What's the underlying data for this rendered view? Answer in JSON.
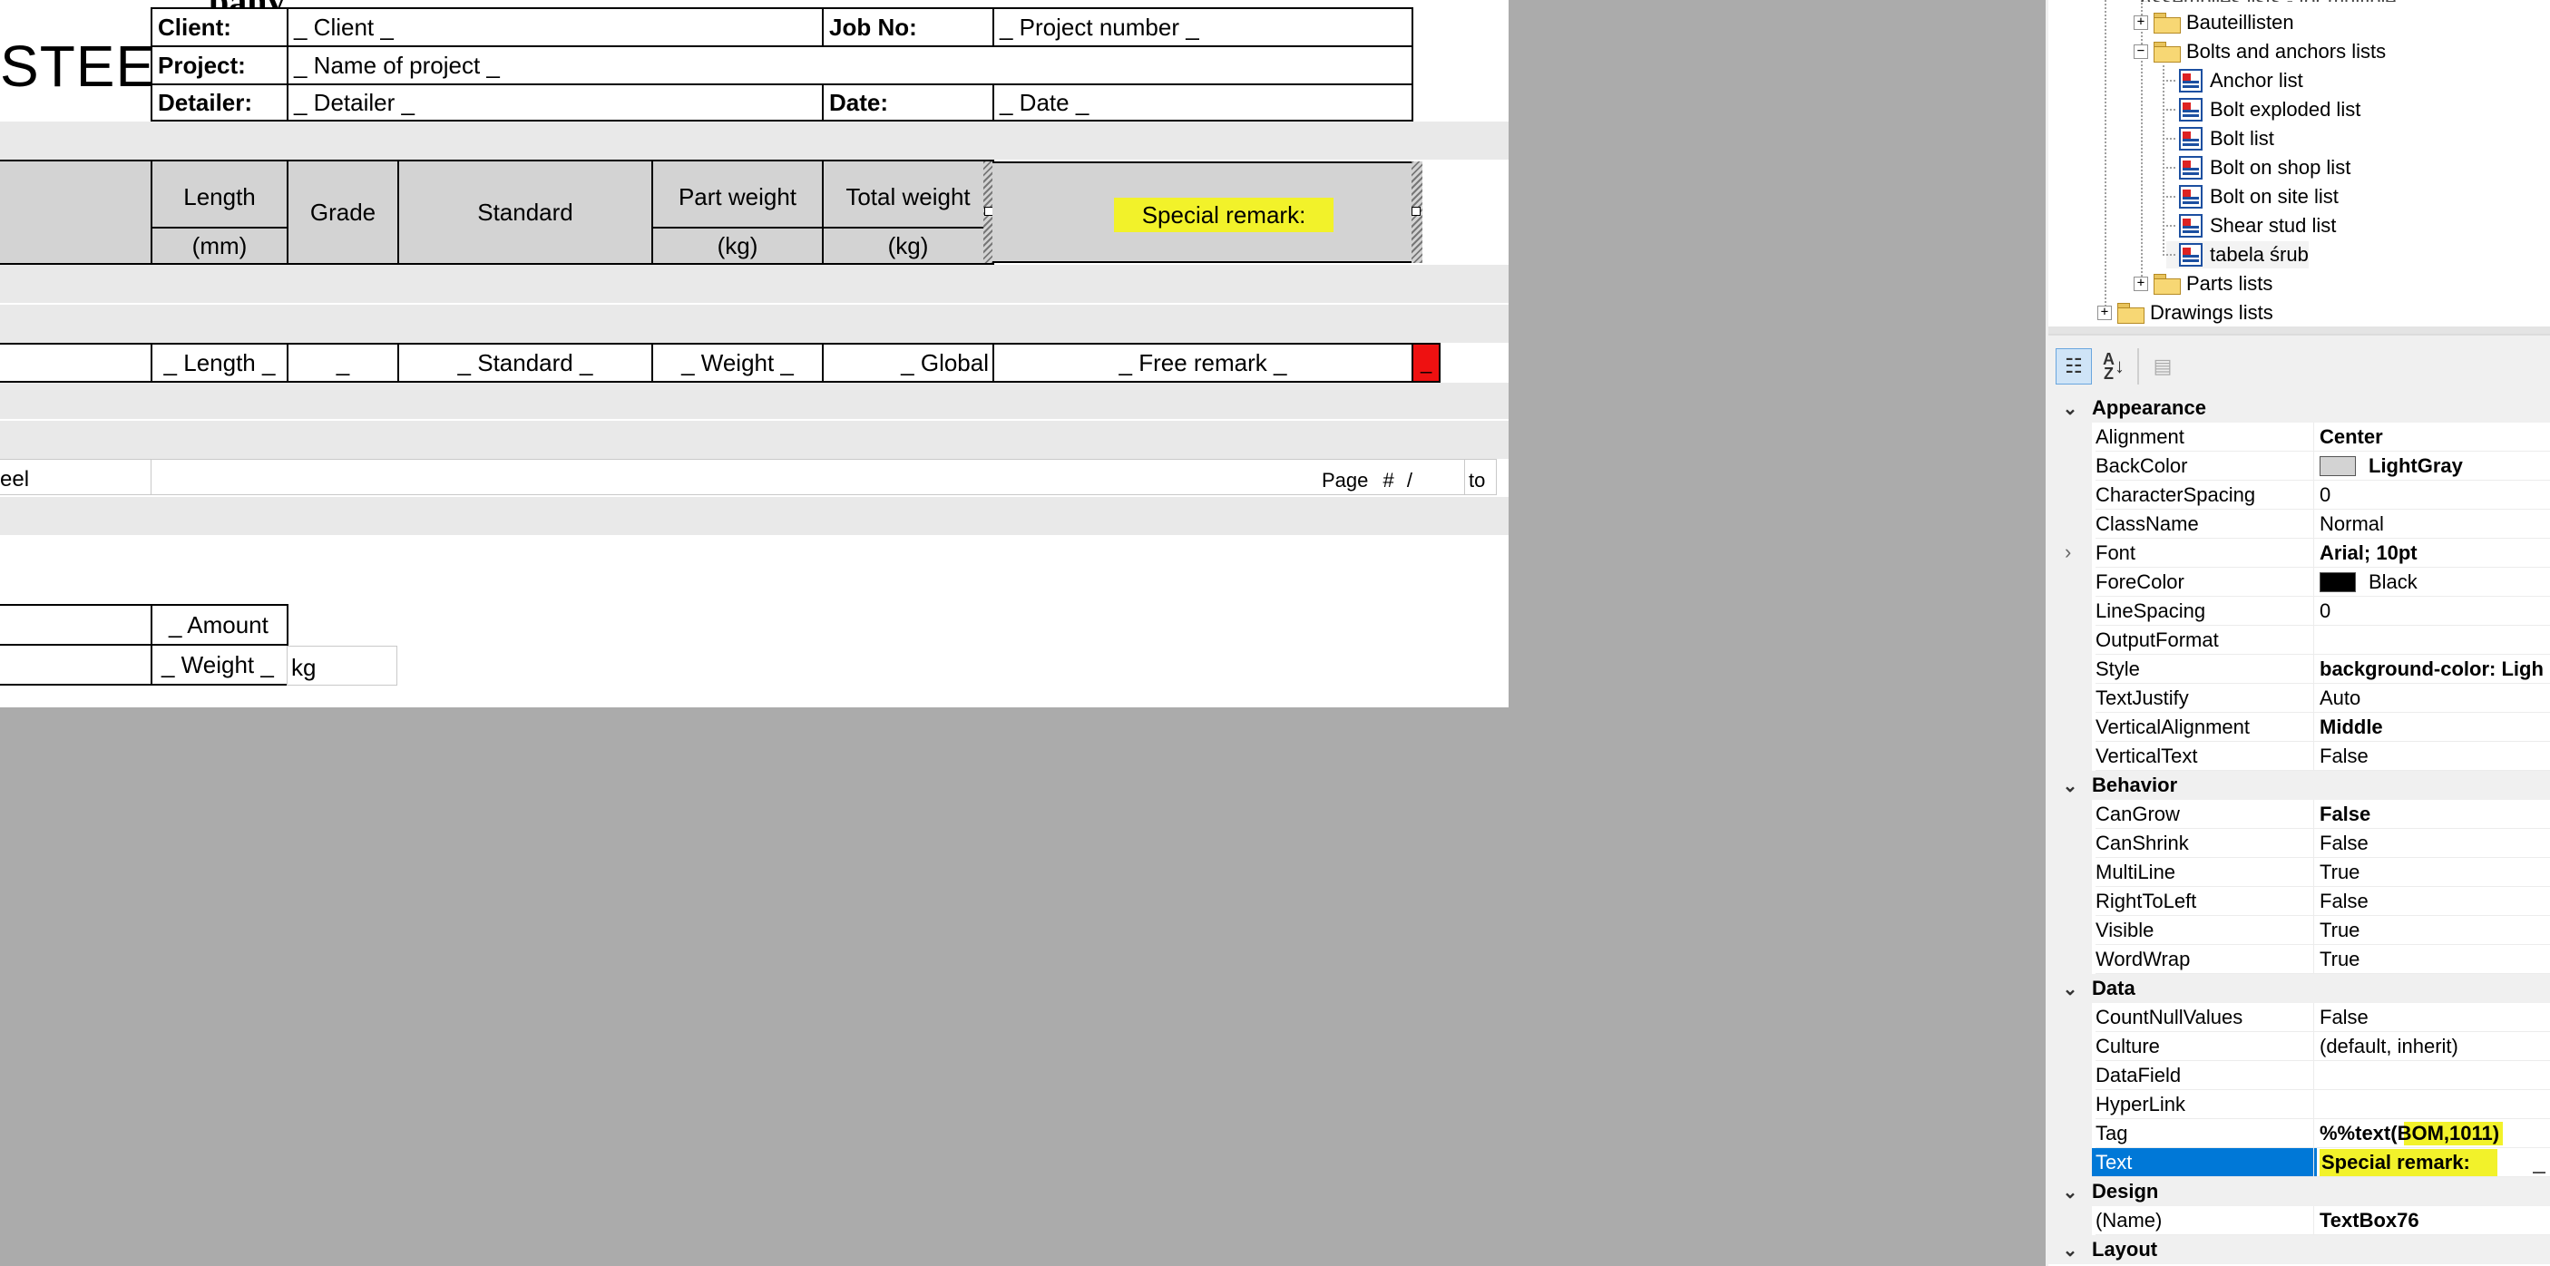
{
  "report": {
    "company_text": "STEEL",
    "header": {
      "client_label": "Client:",
      "client_value": "_ Client _",
      "jobno_label": "Job No:",
      "jobno_value": "_ Project number _",
      "project_label": "Project:",
      "project_value": "_ Name of project _",
      "detailer_label": "Detailer:",
      "detailer_value": "_ Detailer _",
      "date_label": "Date:",
      "date_value": "_ Date _"
    },
    "columns": [
      {
        "label": "Length",
        "unit": "(mm)"
      },
      {
        "label": "Grade",
        "unit": ""
      },
      {
        "label": "Standard",
        "unit": ""
      },
      {
        "label": "Part weight",
        "unit": "(kg)"
      },
      {
        "label": "Total weight",
        "unit": "(kg)"
      },
      {
        "label": "Special remark:",
        "unit": ""
      }
    ],
    "data_row": [
      "_ Length _",
      "_",
      "_ Standard _",
      "_ Weight _",
      "_ Global",
      "_ Free remark _",
      "_"
    ],
    "footer_left": "eel",
    "footer_page": "Page",
    "footer_hash": "#",
    "footer_slash": "/",
    "footer_to": "to",
    "summary": {
      "amount": "_ Amount",
      "weight": "_ Weight _",
      "kg": "kg"
    }
  },
  "tree": {
    "items": [
      {
        "label": "Bauteillisten",
        "kind": "folder",
        "expander": "+"
      },
      {
        "label": "Bolts and anchors lists",
        "kind": "folder",
        "expander": "−"
      },
      {
        "label": "Anchor list",
        "kind": "report"
      },
      {
        "label": "Bolt exploded list",
        "kind": "report"
      },
      {
        "label": "Bolt list",
        "kind": "report"
      },
      {
        "label": "Bolt on shop list",
        "kind": "report"
      },
      {
        "label": "Bolt on site list",
        "kind": "report"
      },
      {
        "label": "Shear stud list",
        "kind": "report"
      },
      {
        "label": "tabela śrub",
        "kind": "report"
      },
      {
        "label": "Parts lists",
        "kind": "folder",
        "expander": "+"
      },
      {
        "label": "Drawings lists",
        "kind": "folder",
        "expander": "+"
      }
    ]
  },
  "toolbar": {
    "categorized_icon": "categorized-icon",
    "alphabetical_icon": "sort-az-icon",
    "property_pages_icon": "property-pages-icon"
  },
  "properties": {
    "appearance": {
      "title": "Appearance",
      "rows": [
        {
          "name": "Alignment",
          "value": "Center",
          "bold": true
        },
        {
          "name": "BackColor",
          "value": "LightGray",
          "bold": true,
          "swatch": "#d3d3d3"
        },
        {
          "name": "CharacterSpacing",
          "value": "0"
        },
        {
          "name": "ClassName",
          "value": "Normal"
        },
        {
          "name": "Font",
          "value": "Arial; 10pt",
          "bold": true,
          "expander": true
        },
        {
          "name": "ForeColor",
          "value": "Black",
          "swatch": "#000000"
        },
        {
          "name": "LineSpacing",
          "value": "0"
        },
        {
          "name": "OutputFormat",
          "value": ""
        },
        {
          "name": "Style",
          "value": "background-color: Ligh",
          "bold": true
        },
        {
          "name": "TextJustify",
          "value": "Auto"
        },
        {
          "name": "VerticalAlignment",
          "value": "Middle",
          "bold": true
        },
        {
          "name": "VerticalText",
          "value": "False"
        }
      ]
    },
    "behavior": {
      "title": "Behavior",
      "rows": [
        {
          "name": "CanGrow",
          "value": "False",
          "bold": true
        },
        {
          "name": "CanShrink",
          "value": "False"
        },
        {
          "name": "MultiLine",
          "value": "True"
        },
        {
          "name": "RightToLeft",
          "value": "False"
        },
        {
          "name": "Visible",
          "value": "True"
        },
        {
          "name": "WordWrap",
          "value": "True"
        }
      ]
    },
    "data": {
      "title": "Data",
      "rows": [
        {
          "name": "CountNullValues",
          "value": "False"
        },
        {
          "name": "Culture",
          "value": "(default, inherit)"
        },
        {
          "name": "DataField",
          "value": ""
        },
        {
          "name": "HyperLink",
          "value": ""
        },
        {
          "name": "Tag",
          "value": "%%text(BOM,1011)",
          "bold": true
        },
        {
          "name": "Text",
          "value": "Special remark:",
          "bold": true,
          "selected": true
        }
      ]
    },
    "design": {
      "title": "Design",
      "rows": [
        {
          "name": "(Name)",
          "value": "TextBox76",
          "bold": true
        }
      ]
    },
    "layout": {
      "title": "Layout"
    }
  },
  "colors": {
    "highlight": "#f2f22a",
    "selection": "#0078d7",
    "marker_red": "#ee1111",
    "header_gray": "#d3d3d3"
  }
}
